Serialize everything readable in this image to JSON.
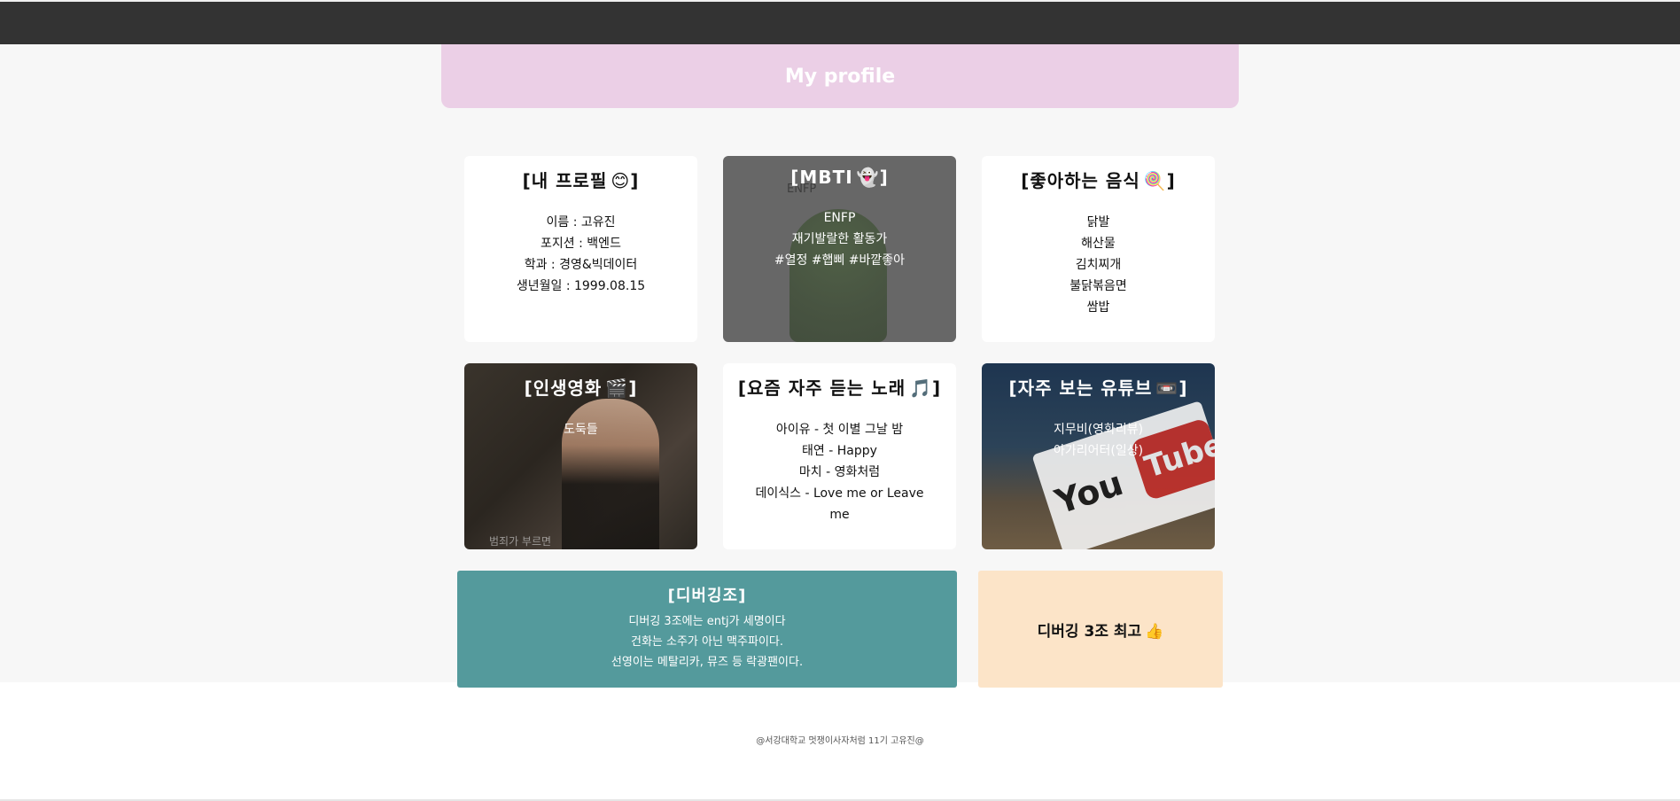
{
  "header": {
    "title": "My profile"
  },
  "cards": {
    "profile": {
      "title": "[내 프로필",
      "emoji": "😊",
      "title_end": "]",
      "lines": [
        "이름 : 고유진",
        "포지션 : 백엔드",
        "학과 : 경영&빅데이터",
        "생년월일 : 1999.08.15"
      ]
    },
    "mbti": {
      "title": "[MBTI",
      "emoji": "👻",
      "title_end": "]",
      "image_caption": "ENFP",
      "lines": [
        "ENFP",
        "재기발랄한 활동가",
        "#열정 #햅삐 #바깥좋아"
      ]
    },
    "food": {
      "title": "[좋아하는 음식",
      "emoji": "🍭",
      "title_end": "]",
      "lines": [
        "닭발",
        "해산물",
        "김치찌개",
        "불닭볶음면",
        "쌈밥"
      ]
    },
    "movie": {
      "title": "[인생영화",
      "emoji": "🎬",
      "title_end": "]",
      "lines": [
        "도둑들"
      ],
      "poster_caption": "범죄가 부르면"
    },
    "music": {
      "title": "[요즘 자주 듣는 노래",
      "emoji": "🎵",
      "title_end": "]",
      "lines": [
        "아이유 - 첫 이별 그날 밤",
        "태연 - Happy",
        "마치 - 영화처럼",
        "데이식스 - Love me or Leave me"
      ]
    },
    "youtube": {
      "title": "[자주 보는 유튜브",
      "emoji": "📼",
      "title_end": "]",
      "lines": [
        "지무비(영화리뷰)",
        "아가리어터(일상)"
      ],
      "logo_you": "You",
      "logo_tube": "Tube"
    },
    "team": {
      "title": "[디버깅조]",
      "lines": [
        "디버깅 3조에는 entj가 세명이다",
        "건화는 소주가 아닌 맥주파이다.",
        "선영이는 메탈리카, 뮤즈 등 락광팬이다."
      ]
    },
    "cheer": {
      "text": "디버깅 3조 최고",
      "emoji": "👍"
    }
  },
  "footer": {
    "text": "@서강대학교 멋쟁이사자처럼 11기 고유진@"
  },
  "colors": {
    "topbar": "#333333",
    "header": "#ebcfe6",
    "dark_card": "#676767",
    "teal_card": "#549a9c",
    "peach_card": "#fce4c8"
  }
}
